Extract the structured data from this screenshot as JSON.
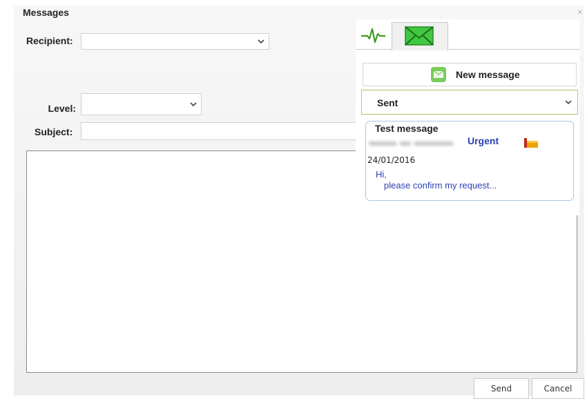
{
  "window": {
    "title": "Messages",
    "close_glyph": "✕"
  },
  "form": {
    "recipient_label": "Recipient:",
    "recipient_value": "",
    "level_label": "Level:",
    "level_value": "",
    "subject_label": "Subject:",
    "subject_value": "",
    "body_value": ""
  },
  "buttons": {
    "send": "Send",
    "cancel": "Cancel"
  },
  "panel": {
    "tabs": [
      {
        "icon": "activity-pulse-icon",
        "active": false
      },
      {
        "icon": "envelope-icon",
        "active": true
      }
    ],
    "new_message_label": "New message",
    "folder_selected": "Sent",
    "messages": [
      {
        "subject": "Test message",
        "level": "Urgent",
        "date": "24/01/2016",
        "preview_line1": "Hi,",
        "preview_line2": "please confirm my request...",
        "flag_icon": "urgent-flag-icon"
      }
    ]
  },
  "colors": {
    "accent_green": "#3c9a1f",
    "message_blue": "#2a3fb0",
    "card_border": "#a9c4e4",
    "select_border_green": "#a8c86a",
    "urgent_flag": "#e8a000"
  }
}
